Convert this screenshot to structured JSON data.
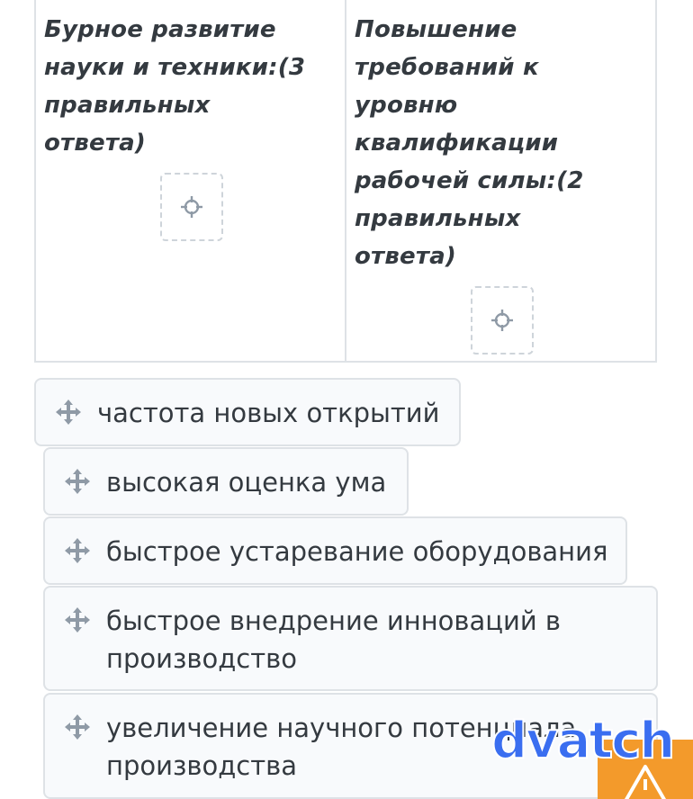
{
  "categories": [
    {
      "heading": "Бурное развитие науки и техники:(3 правильных ответа)"
    },
    {
      "heading": "Повышение требований к уровню квалификации рабочей силы:(2 правильных ответа)"
    }
  ],
  "choices": [
    {
      "label": "частота новых открытий"
    },
    {
      "label": "высокая оценка ума"
    },
    {
      "label": "быстрое устаревание оборудования"
    },
    {
      "label": "быстрое внедрение инноваций в производство"
    },
    {
      "label": "увеличение научного потенциала производства"
    }
  ],
  "icons": {
    "drop_zone": "target-icon",
    "drag_handle": "move-icon",
    "badge": "warning-icon"
  },
  "watermark": {
    "text": "dvatch"
  },
  "colors": {
    "border": "#dee2e6",
    "text": "#343a40",
    "icon": "#8f9aa6",
    "choice_bg": "#f8fafc",
    "watermark": "#3a6ef0",
    "badge": "#f39a2b"
  }
}
